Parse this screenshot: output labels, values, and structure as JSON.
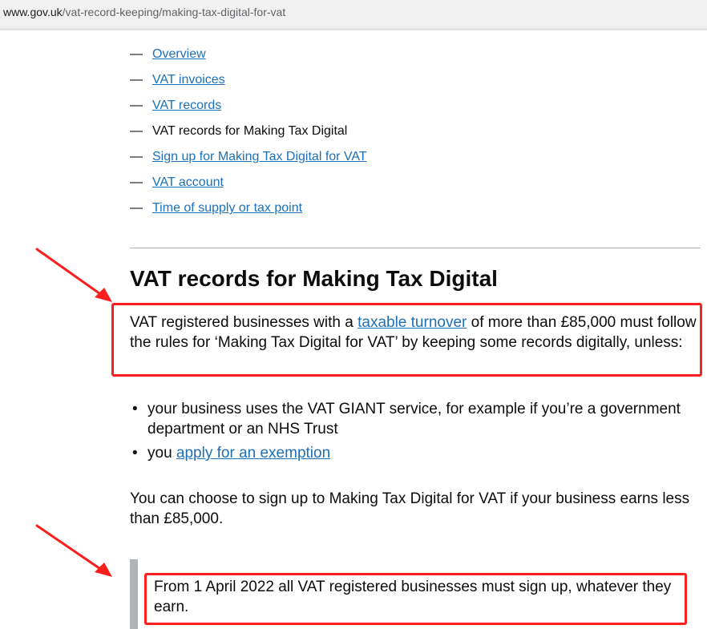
{
  "browser": {
    "url_host": "www.gov.uk",
    "url_path": "/vat-record-keeping/making-tax-digital-for-vat"
  },
  "contents": {
    "items": [
      {
        "label": "Overview",
        "link": true
      },
      {
        "label": "VAT invoices",
        "link": true
      },
      {
        "label": "VAT records",
        "link": true
      },
      {
        "label": "VAT records for Making Tax Digital",
        "link": false
      },
      {
        "label": "Sign up for Making Tax Digital for VAT",
        "link": true
      },
      {
        "label": "VAT account",
        "link": true
      },
      {
        "label": "Time of supply or tax point",
        "link": true
      }
    ],
    "dash": "—"
  },
  "main": {
    "title": "VAT records for Making Tax Digital",
    "intro_pre": "VAT registered businesses with a ",
    "intro_link": "taxable turnover",
    "intro_post": " of more than £85,000 must follow the rules for ‘Making Tax Digital for VAT’ by keeping some records digitally, unless:",
    "bullet1": "your business uses the VAT GIANT service, for example if you’re a government department or an NHS Trust",
    "bullet2_pre": "you ",
    "bullet2_link": "apply for an exemption",
    "choose_text": "You can choose to sign up to Making Tax Digital for VAT if your business earns less than £85,000.",
    "inset_text": "From 1 April 2022 all VAT registered businesses must sign up, whatever they earn."
  },
  "annotation": {
    "color": "#ff1e1e"
  }
}
